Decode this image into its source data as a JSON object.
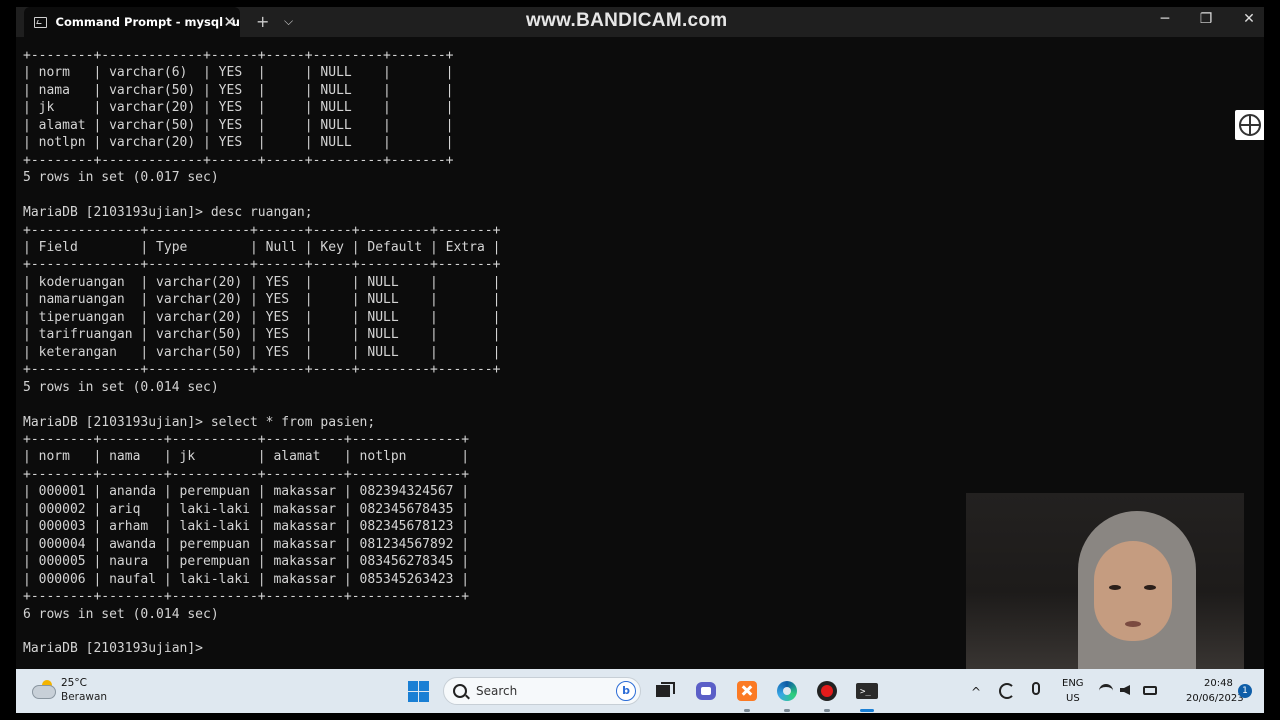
{
  "window": {
    "tab_title": "Command Prompt - mysql -u",
    "tab_close": "✕",
    "new_tab": "+",
    "tab_dropdown": "⌵",
    "minimize": "─",
    "maximize": "❐",
    "close": "✕"
  },
  "watermark": "www.BANDICAM.com",
  "terminal": {
    "lines": [
      "+--------+-------------+------+-----+---------+-------+",
      "| norm   | varchar(6)  | YES  |     | NULL    |       |",
      "| nama   | varchar(50) | YES  |     | NULL    |       |",
      "| jk     | varchar(20) | YES  |     | NULL    |       |",
      "| alamat | varchar(50) | YES  |     | NULL    |       |",
      "| notlpn | varchar(20) | YES  |     | NULL    |       |",
      "+--------+-------------+------+-----+---------+-------+",
      "5 rows in set (0.017 sec)",
      "",
      "MariaDB [2103193ujian]> desc ruangan;",
      "+--------------+-------------+------+-----+---------+-------+",
      "| Field        | Type        | Null | Key | Default | Extra |",
      "+--------------+-------------+------+-----+---------+-------+",
      "| koderuangan  | varchar(20) | YES  |     | NULL    |       |",
      "| namaruangan  | varchar(20) | YES  |     | NULL    |       |",
      "| tiperuangan  | varchar(20) | YES  |     | NULL    |       |",
      "| tarifruangan | varchar(50) | YES  |     | NULL    |       |",
      "| keterangan   | varchar(50) | YES  |     | NULL    |       |",
      "+--------------+-------------+------+-----+---------+-------+",
      "5 rows in set (0.014 sec)",
      "",
      "MariaDB [2103193ujian]> select * from pasien;",
      "+--------+--------+-----------+----------+--------------+",
      "| norm   | nama   | jk        | alamat   | notlpn       |",
      "+--------+--------+-----------+----------+--------------+",
      "| 000001 | ananda | perempuan | makassar | 082394324567 |",
      "| 000002 | ariq   | laki-laki | makassar | 082345678435 |",
      "| 000003 | arham  | laki-laki | makassar | 082345678123 |",
      "| 000004 | awanda | perempuan | makassar | 081234567892 |",
      "| 000005 | naura  | perempuan | makassar | 083456278345 |",
      "| 000006 | naufal | laki-laki | makassar | 085345263423 |",
      "+--------+--------+-----------+----------+--------------+",
      "6 rows in set (0.014 sec)",
      "",
      "MariaDB [2103193ujian]>"
    ]
  },
  "taskbar": {
    "weather_temp": "25°C",
    "weather_condition": "Berawan",
    "search_placeholder": "Search",
    "bing_letter": "b",
    "tray_chevron": "^",
    "lang_primary": "ENG",
    "lang_secondary": "US",
    "time": "20:48",
    "date": "20/06/2023",
    "notification_count": "1",
    "accent": "#1a7fd4"
  }
}
